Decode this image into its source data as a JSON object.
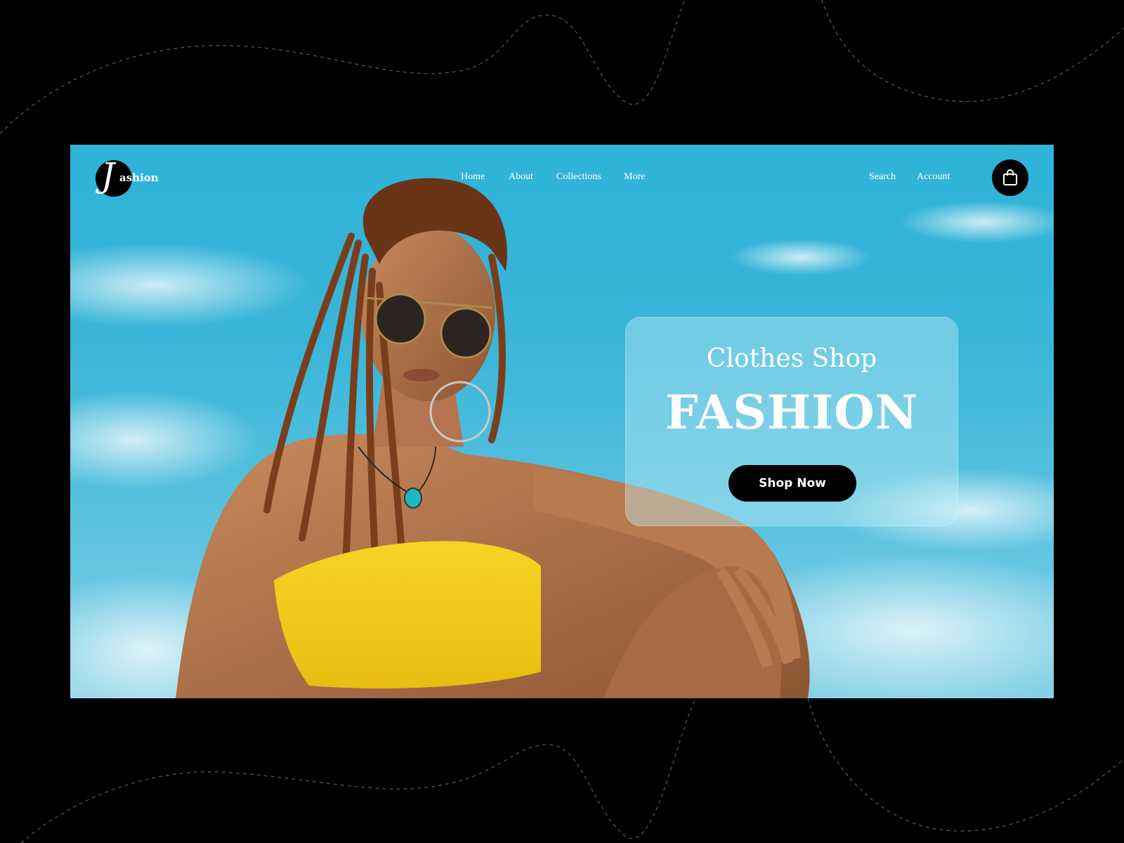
{
  "logo": {
    "mark": "J",
    "text": "ashion"
  },
  "nav": {
    "links": [
      {
        "label": "Home"
      },
      {
        "label": "About"
      },
      {
        "label": "Collections"
      },
      {
        "label": "More"
      }
    ],
    "search_label": "Search",
    "account_label": "Account",
    "cart_icon": "shopping-bag-icon"
  },
  "hero": {
    "subtitle": "Clothes Shop",
    "title": "FASHION",
    "cta_label": "Shop Now"
  },
  "colors": {
    "sky": "#35b4d9",
    "accent_dark": "#000000",
    "top_yellow": "#f4cf1f",
    "text_light": "#ffffff"
  }
}
